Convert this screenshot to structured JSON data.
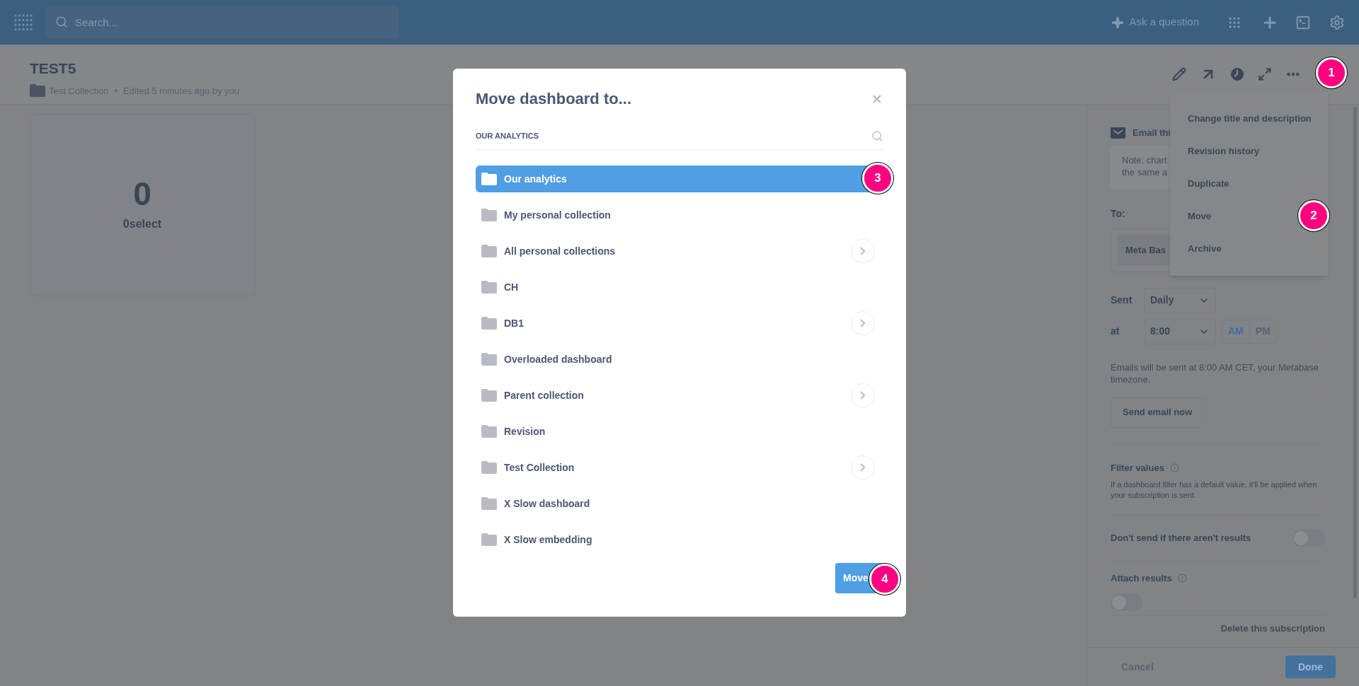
{
  "top_bar": {
    "search": {
      "placeholder": "Search..."
    },
    "ask_button": "Ask a question"
  },
  "dashboard": {
    "title": "TEST5",
    "collection": "Test Collection",
    "separator": "•",
    "edited": "Edited 5 minutes ago by you",
    "card": {
      "value": "0",
      "label": "0select"
    }
  },
  "actions_menu": {
    "items": [
      "Change title and description",
      "Revision history",
      "Duplicate",
      "Move",
      "Archive"
    ]
  },
  "subscription_panel": {
    "email_heading": "Email thi",
    "note_lines": [
      "Note: chart",
      "the same a"
    ],
    "to_label": "To:",
    "recipient": "Meta Bas",
    "sent_label": "Sent",
    "frequency": "Daily",
    "at_label": "at",
    "time": "8:00",
    "periods": [
      {
        "label": "AM",
        "selected": true
      },
      {
        "label": "PM",
        "selected": false
      }
    ],
    "timezone_note": "Emails will be sent at 8:00 AM CET, your Metabase timezone.",
    "send_now": "Send email now",
    "filter_title": "Filter values",
    "filter_note": "If a dashboard filter has a default value, it'll be applied when your subscription is sent.",
    "toggles": [
      {
        "kind": "inline",
        "label": "Don't send if there aren't results",
        "on": false
      },
      {
        "kind": "stacked",
        "label": "Attach results",
        "on": false
      }
    ],
    "delete_link": "Delete this subscription",
    "cancel": "Cancel",
    "done": "Done"
  },
  "modal": {
    "title": "Move dashboard to...",
    "breadcrumb": "OUR ANALYTICS",
    "items": [
      {
        "label": "Our analytics",
        "selected": true,
        "has_children": false
      },
      {
        "label": "My personal collection",
        "selected": false,
        "has_children": false
      },
      {
        "label": "All personal collections",
        "selected": false,
        "has_children": true
      },
      {
        "label": "CH",
        "selected": false,
        "has_children": false
      },
      {
        "label": "DB1",
        "selected": false,
        "has_children": true
      },
      {
        "label": "Overloaded dashboard",
        "selected": false,
        "has_children": false
      },
      {
        "label": "Parent collection",
        "selected": false,
        "has_children": true
      },
      {
        "label": "Revision",
        "selected": false,
        "has_children": false
      },
      {
        "label": "Test Collection",
        "selected": false,
        "has_children": true
      },
      {
        "label": "X Slow dashboard",
        "selected": false,
        "has_children": false
      },
      {
        "label": "X Slow embedding",
        "selected": false,
        "has_children": false
      }
    ],
    "move_button": "Move"
  },
  "markers": [
    "1",
    "2",
    "3",
    "4"
  ]
}
